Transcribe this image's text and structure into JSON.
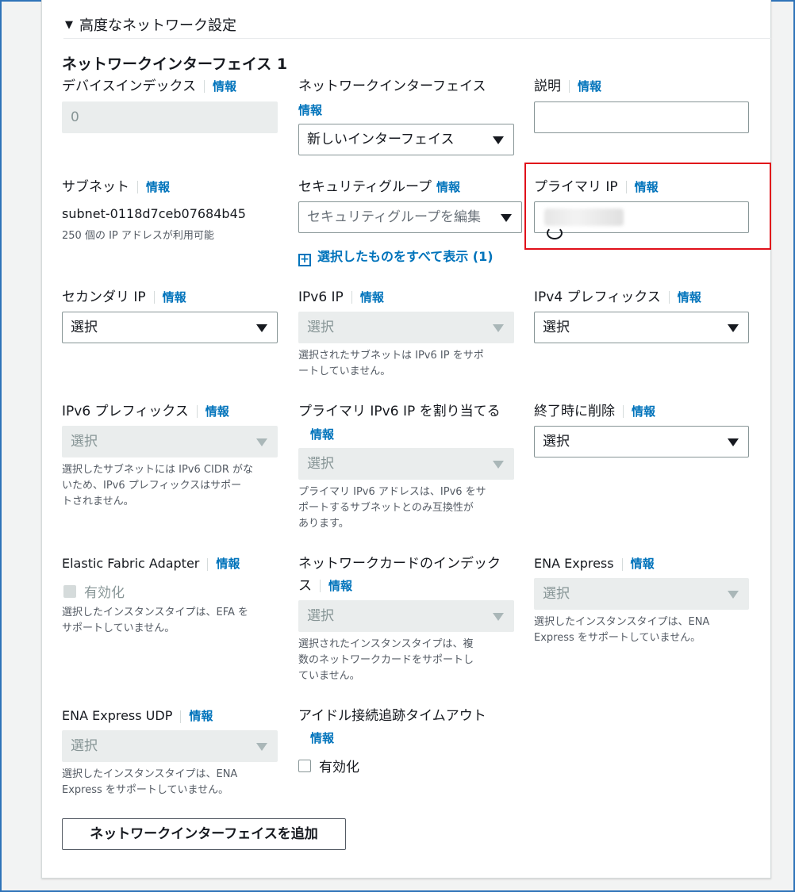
{
  "section": {
    "caret": "▼",
    "title": "高度なネットワーク設定"
  },
  "interface": {
    "title": "ネットワークインターフェイス 1"
  },
  "info_label": "情報",
  "fields": {
    "device_index": {
      "label": "デバイスインデックス",
      "value": "0"
    },
    "network_interface": {
      "label": "ネットワークインターフェイス",
      "value": "新しいインターフェイス"
    },
    "description": {
      "label": "説明",
      "value": ""
    },
    "subnet": {
      "label": "サブネット",
      "value": "subnet-0118d7ceb07684b45",
      "note": "250 個の IP アドレスが利用可能"
    },
    "security_group": {
      "label": "セキュリティグループ",
      "placeholder": "セキュリティグループを編集",
      "link": "選択したものをすべて表示 (1)"
    },
    "primary_ip": {
      "label": "プライマリ IP"
    },
    "secondary_ip": {
      "label": "セカンダリ IP",
      "value": "選択"
    },
    "ipv6_ip": {
      "label": "IPv6 IP",
      "value": "選択",
      "note_1": "選択されたサブネットは IPv6 IP をサポ",
      "note_2": "ートしていません。"
    },
    "ipv4_prefix": {
      "label": "IPv4 プレフィックス",
      "value": "選択"
    },
    "ipv6_prefix": {
      "label": "IPv6 プレフィックス",
      "value": "選択",
      "note_1": "選択したサブネットには IPv6 CIDR がな",
      "note_2": "いため、IPv6 プレフィックスはサポー",
      "note_3": "トされません。"
    },
    "assign_primary_ipv6": {
      "label": "プライマリ IPv6 IP を割り当てる",
      "value": "選択",
      "note_1": "プライマリ IPv6 アドレスは、IPv6 をサ",
      "note_2": "ポートするサブネットとのみ互換性が",
      "note_3": "あります。"
    },
    "delete_on_termination": {
      "label": "終了時に削除",
      "value": "選択"
    },
    "efa": {
      "label": "Elastic Fabric Adapter",
      "checkbox": "有効化",
      "note_1": "選択したインスタンスタイプは、EFA を",
      "note_2": "サポートしていません。"
    },
    "network_card_index": {
      "label_1": "ネットワークカードのインデック",
      "label_2": "ス",
      "value": "選択",
      "note_1": "選択されたインスタンスタイプは、複",
      "note_2": "数のネットワークカードをサポートし",
      "note_3": "ていません。"
    },
    "ena_express": {
      "label": "ENA Express",
      "value": "選択",
      "note_1": "選択したインスタンスタイプは、ENA",
      "note_2": "Express をサポートしていません。"
    },
    "ena_express_udp": {
      "label": "ENA Express UDP",
      "value": "選択",
      "note_1": "選択したインスタンスタイプは、ENA",
      "note_2": "Express をサポートしていません。"
    },
    "idle_timeout": {
      "label": "アイドル接続追跡タイムアウト",
      "checkbox": "有効化"
    }
  },
  "buttons": {
    "add_interface": "ネットワークインターフェイスを追加"
  },
  "colors": {
    "link": "#0073bb",
    "highlight": "#e0101a",
    "frame": "#2e73b8"
  }
}
